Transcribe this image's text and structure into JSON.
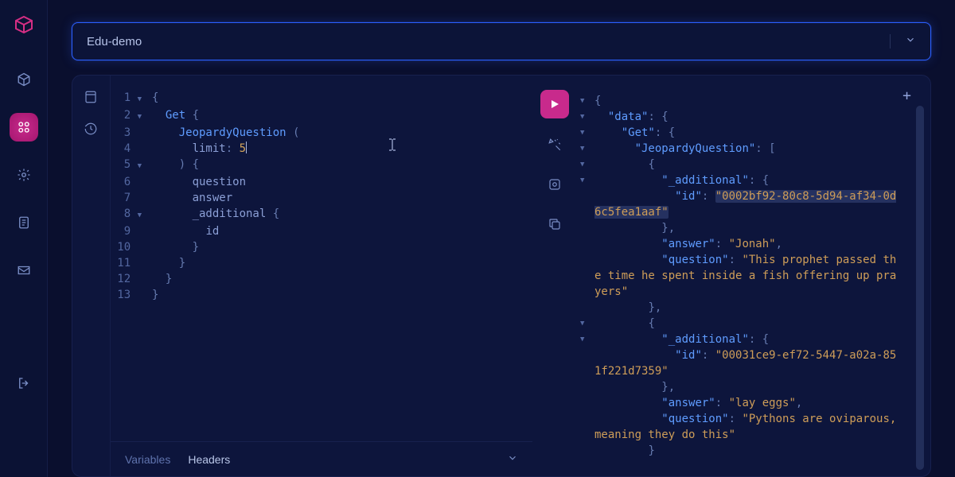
{
  "colors": {
    "accent": "#c82a8c",
    "border_focus": "#2a5fff",
    "bg": "#0a0f2e"
  },
  "instance": {
    "name": "Edu-demo"
  },
  "sidebar": {
    "items": [
      "cube",
      "apps",
      "settings",
      "document",
      "inbox",
      "logout"
    ],
    "active_index": 1
  },
  "card_rail": {
    "items": [
      "explorer",
      "history"
    ]
  },
  "query": {
    "lines": [
      {
        "n": 1,
        "fold": true,
        "text": "{"
      },
      {
        "n": 2,
        "fold": true,
        "text": "  Get {"
      },
      {
        "n": 3,
        "fold": false,
        "text": "    JeopardyQuestion ("
      },
      {
        "n": 4,
        "fold": false,
        "text": "      limit: 5"
      },
      {
        "n": 5,
        "fold": true,
        "text": "    ) {"
      },
      {
        "n": 6,
        "fold": false,
        "text": "      question"
      },
      {
        "n": 7,
        "fold": false,
        "text": "      answer"
      },
      {
        "n": 8,
        "fold": true,
        "text": "      _additional {"
      },
      {
        "n": 9,
        "fold": false,
        "text": "        id"
      },
      {
        "n": 10,
        "fold": false,
        "text": "      }"
      },
      {
        "n": 11,
        "fold": false,
        "text": "    }"
      },
      {
        "n": 12,
        "fold": false,
        "text": "  }"
      },
      {
        "n": 13,
        "fold": false,
        "text": "}"
      }
    ],
    "query_tokens": {
      "Get": "keyword",
      "JeopardyQuestion": "type",
      "limit": "arg",
      "5": "number",
      "question": "field",
      "answer": "field",
      "_additional": "field",
      "id": "field"
    }
  },
  "tabs": {
    "items": [
      "Variables",
      "Headers"
    ],
    "active_index": 1
  },
  "action_rail": {
    "items": [
      "run",
      "prettify",
      "merge",
      "copy"
    ]
  },
  "result": {
    "data": {
      "Get": {
        "JeopardyQuestion": [
          {
            "_additional": {
              "id": "0002bf92-80c8-5d94-af34-0d6c5fea1aaf"
            },
            "answer": "Jonah",
            "question": "This prophet passed the time he spent inside a fish offering up prayers"
          },
          {
            "_additional": {
              "id": "00031ce9-ef72-5447-a02a-851f221d7359"
            },
            "answer": "lay eggs",
            "question": "Pythons are oviparous, meaning they do this"
          }
        ]
      }
    },
    "highlighted_id": "0002bf92-80c8-5d94-af34-0d6c5fea1aaf"
  }
}
